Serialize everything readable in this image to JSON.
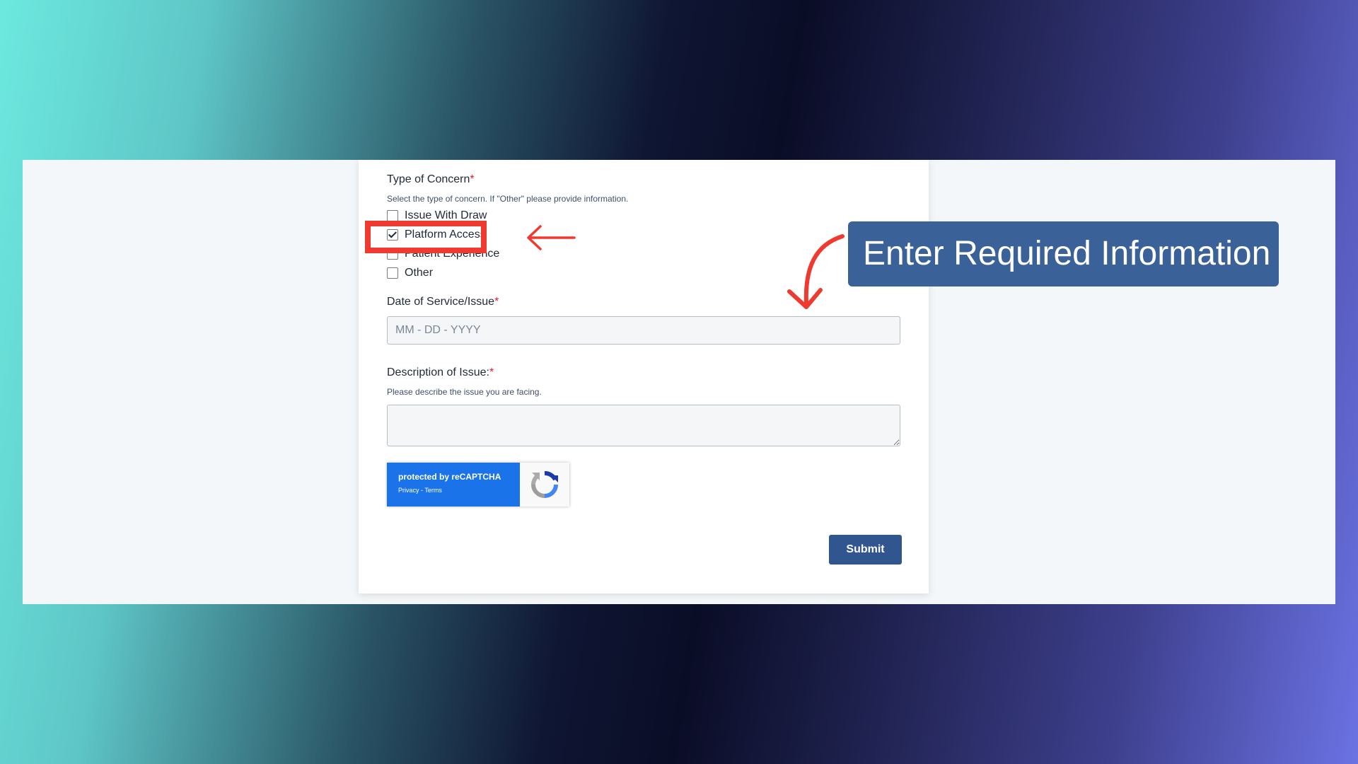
{
  "form": {
    "concern_label": "Type of Concern",
    "required_mark": "*",
    "concern_help": "Select the type of concern. If \"Other\" please provide information.",
    "options": [
      {
        "label": "Issue With Draw",
        "checked": false
      },
      {
        "label": "Platform Access",
        "checked": true
      },
      {
        "label": "Patient Experience",
        "checked": false
      },
      {
        "label": "Other",
        "checked": false
      }
    ],
    "date_label": "Date of Service/Issue",
    "date_placeholder": "MM - DD - YYYY",
    "date_value": "",
    "description_label": "Description of Issue:",
    "description_help": "Please describe the issue you are facing.",
    "description_value": "",
    "submit_label": "Submit"
  },
  "recaptcha": {
    "protected_text": "protected by reCAPTCHA",
    "links_text": "Privacy - Terms",
    "logo_icon": "recaptcha-logo-icon"
  },
  "annotation": {
    "callout_text": "Enter Required Information",
    "highlight_color": "#ef3a30",
    "callout_color": "#3a6198",
    "arrow_icons": [
      "arrow-left-icon",
      "curved-arrow-down-icon"
    ]
  },
  "colors": {
    "submit_button": "#31568f",
    "recaptcha_blue": "#1a73e8",
    "required_red": "#e11d2e"
  }
}
